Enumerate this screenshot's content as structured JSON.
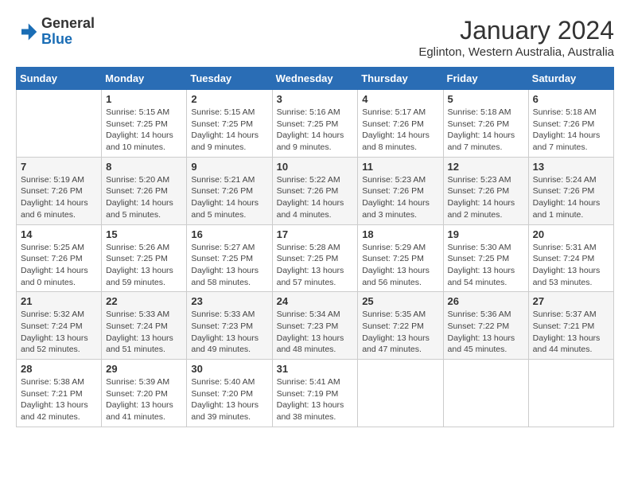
{
  "logo": {
    "general": "General",
    "blue": "Blue"
  },
  "header": {
    "month": "January 2024",
    "location": "Eglinton, Western Australia, Australia"
  },
  "days_of_week": [
    "Sunday",
    "Monday",
    "Tuesday",
    "Wednesday",
    "Thursday",
    "Friday",
    "Saturday"
  ],
  "weeks": [
    [
      {
        "day": "",
        "info": ""
      },
      {
        "day": "1",
        "info": "Sunrise: 5:15 AM\nSunset: 7:25 PM\nDaylight: 14 hours\nand 10 minutes."
      },
      {
        "day": "2",
        "info": "Sunrise: 5:15 AM\nSunset: 7:25 PM\nDaylight: 14 hours\nand 9 minutes."
      },
      {
        "day": "3",
        "info": "Sunrise: 5:16 AM\nSunset: 7:25 PM\nDaylight: 14 hours\nand 9 minutes."
      },
      {
        "day": "4",
        "info": "Sunrise: 5:17 AM\nSunset: 7:26 PM\nDaylight: 14 hours\nand 8 minutes."
      },
      {
        "day": "5",
        "info": "Sunrise: 5:18 AM\nSunset: 7:26 PM\nDaylight: 14 hours\nand 7 minutes."
      },
      {
        "day": "6",
        "info": "Sunrise: 5:18 AM\nSunset: 7:26 PM\nDaylight: 14 hours\nand 7 minutes."
      }
    ],
    [
      {
        "day": "7",
        "info": "Sunrise: 5:19 AM\nSunset: 7:26 PM\nDaylight: 14 hours\nand 6 minutes."
      },
      {
        "day": "8",
        "info": "Sunrise: 5:20 AM\nSunset: 7:26 PM\nDaylight: 14 hours\nand 5 minutes."
      },
      {
        "day": "9",
        "info": "Sunrise: 5:21 AM\nSunset: 7:26 PM\nDaylight: 14 hours\nand 5 minutes."
      },
      {
        "day": "10",
        "info": "Sunrise: 5:22 AM\nSunset: 7:26 PM\nDaylight: 14 hours\nand 4 minutes."
      },
      {
        "day": "11",
        "info": "Sunrise: 5:23 AM\nSunset: 7:26 PM\nDaylight: 14 hours\nand 3 minutes."
      },
      {
        "day": "12",
        "info": "Sunrise: 5:23 AM\nSunset: 7:26 PM\nDaylight: 14 hours\nand 2 minutes."
      },
      {
        "day": "13",
        "info": "Sunrise: 5:24 AM\nSunset: 7:26 PM\nDaylight: 14 hours\nand 1 minute."
      }
    ],
    [
      {
        "day": "14",
        "info": "Sunrise: 5:25 AM\nSunset: 7:26 PM\nDaylight: 14 hours\nand 0 minutes."
      },
      {
        "day": "15",
        "info": "Sunrise: 5:26 AM\nSunset: 7:25 PM\nDaylight: 13 hours\nand 59 minutes."
      },
      {
        "day": "16",
        "info": "Sunrise: 5:27 AM\nSunset: 7:25 PM\nDaylight: 13 hours\nand 58 minutes."
      },
      {
        "day": "17",
        "info": "Sunrise: 5:28 AM\nSunset: 7:25 PM\nDaylight: 13 hours\nand 57 minutes."
      },
      {
        "day": "18",
        "info": "Sunrise: 5:29 AM\nSunset: 7:25 PM\nDaylight: 13 hours\nand 56 minutes."
      },
      {
        "day": "19",
        "info": "Sunrise: 5:30 AM\nSunset: 7:25 PM\nDaylight: 13 hours\nand 54 minutes."
      },
      {
        "day": "20",
        "info": "Sunrise: 5:31 AM\nSunset: 7:24 PM\nDaylight: 13 hours\nand 53 minutes."
      }
    ],
    [
      {
        "day": "21",
        "info": "Sunrise: 5:32 AM\nSunset: 7:24 PM\nDaylight: 13 hours\nand 52 minutes."
      },
      {
        "day": "22",
        "info": "Sunrise: 5:33 AM\nSunset: 7:24 PM\nDaylight: 13 hours\nand 51 minutes."
      },
      {
        "day": "23",
        "info": "Sunrise: 5:33 AM\nSunset: 7:23 PM\nDaylight: 13 hours\nand 49 minutes."
      },
      {
        "day": "24",
        "info": "Sunrise: 5:34 AM\nSunset: 7:23 PM\nDaylight: 13 hours\nand 48 minutes."
      },
      {
        "day": "25",
        "info": "Sunrise: 5:35 AM\nSunset: 7:22 PM\nDaylight: 13 hours\nand 47 minutes."
      },
      {
        "day": "26",
        "info": "Sunrise: 5:36 AM\nSunset: 7:22 PM\nDaylight: 13 hours\nand 45 minutes."
      },
      {
        "day": "27",
        "info": "Sunrise: 5:37 AM\nSunset: 7:21 PM\nDaylight: 13 hours\nand 44 minutes."
      }
    ],
    [
      {
        "day": "28",
        "info": "Sunrise: 5:38 AM\nSunset: 7:21 PM\nDaylight: 13 hours\nand 42 minutes."
      },
      {
        "day": "29",
        "info": "Sunrise: 5:39 AM\nSunset: 7:20 PM\nDaylight: 13 hours\nand 41 minutes."
      },
      {
        "day": "30",
        "info": "Sunrise: 5:40 AM\nSunset: 7:20 PM\nDaylight: 13 hours\nand 39 minutes."
      },
      {
        "day": "31",
        "info": "Sunrise: 5:41 AM\nSunset: 7:19 PM\nDaylight: 13 hours\nand 38 minutes."
      },
      {
        "day": "",
        "info": ""
      },
      {
        "day": "",
        "info": ""
      },
      {
        "day": "",
        "info": ""
      }
    ]
  ]
}
